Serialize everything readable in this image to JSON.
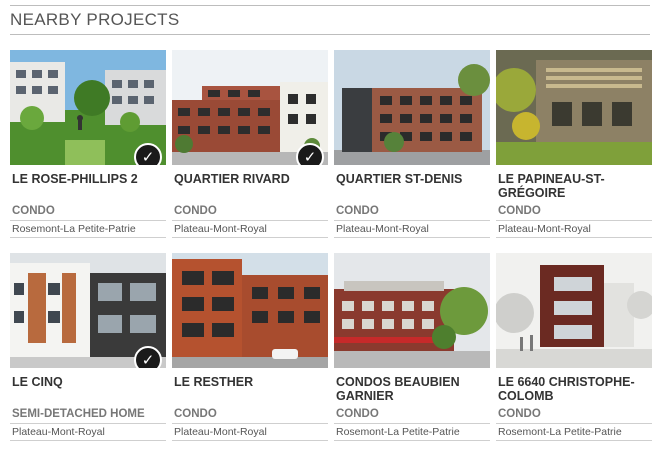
{
  "header": {
    "title": "NEARBY PROJECTS"
  },
  "projects": [
    {
      "name": "LE ROSE-PHILLIPS 2",
      "type": "CONDO",
      "location": "Rosemont-La Petite-Patrie",
      "collection_badge": true
    },
    {
      "name": "QUARTIER RIVARD",
      "type": "CONDO",
      "location": "Plateau-Mont-Royal",
      "collection_badge": true
    },
    {
      "name": "QUARTIER ST-DENIS",
      "type": "CONDO",
      "location": "Plateau-Mont-Royal",
      "collection_badge": false
    },
    {
      "name": "LE PAPINEAU-ST-GRÉGOIRE",
      "type": "CONDO",
      "location": "Plateau-Mont-Royal",
      "collection_badge": false
    },
    {
      "name": "LE CINQ",
      "type": "SEMI-DETACHED HOME",
      "location": "Plateau-Mont-Royal",
      "collection_badge": true
    },
    {
      "name": "LE RESTHER",
      "type": "CONDO",
      "location": "Plateau-Mont-Royal",
      "collection_badge": false
    },
    {
      "name": "CONDOS BEAUBIEN GARNIER",
      "type": "CONDO",
      "location": "Rosemont-La Petite-Patrie",
      "collection_badge": false
    },
    {
      "name": "LE 6640 CHRISTOPHE-COLOMB",
      "type": "CONDO",
      "location": "Rosemont-La Petite-Patrie",
      "collection_badge": false
    }
  ],
  "icons": {
    "badge": "checkmark-badge-icon"
  }
}
